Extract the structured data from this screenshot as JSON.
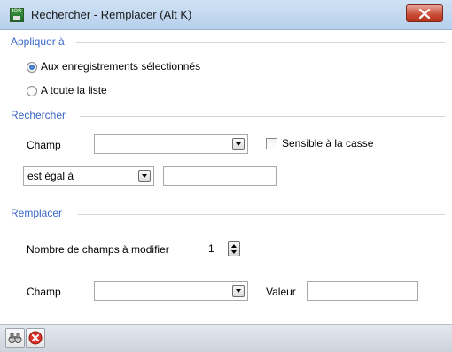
{
  "window": {
    "title": "Rechercher - Remplacer (Alt K)",
    "app_icon_text": "IOR"
  },
  "apply": {
    "legend": "Appliquer à",
    "option_selected_label": "Aux enregistrements sélectionnés",
    "option_selected_checked": true,
    "option_all_label": "A toute la liste",
    "option_all_checked": false
  },
  "search": {
    "legend": "Rechercher",
    "field_label": "Champ",
    "field_value": "",
    "case_sensitive_label": "Sensible à la casse",
    "case_sensitive_checked": false,
    "operator_value": "est égal à",
    "value": ""
  },
  "replace": {
    "legend": "Remplacer",
    "count_label": "Nombre de champs à modifier",
    "count_value": "1",
    "field_label": "Champ",
    "field_value": "",
    "value_label": "Valeur",
    "value": ""
  },
  "toolbar": {
    "buttons": [
      {
        "icon": "binoculars-icon"
      },
      {
        "icon": "cancel-icon"
      }
    ]
  },
  "colors": {
    "section_legend": "#3a66c8",
    "close_button": "#c94a35"
  }
}
